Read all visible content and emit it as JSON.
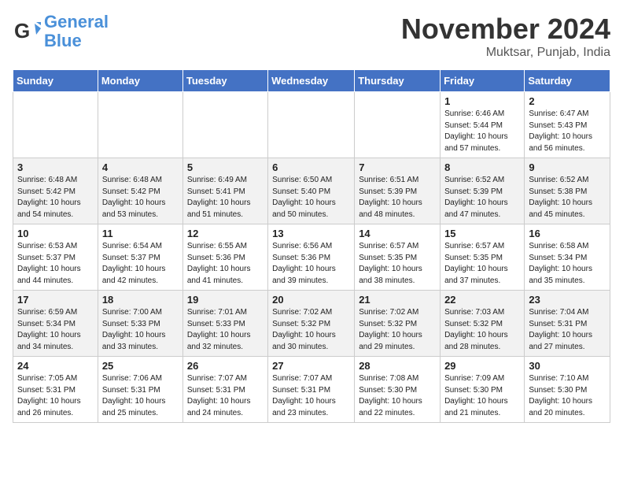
{
  "header": {
    "logo_line1": "General",
    "logo_line2": "Blue",
    "month": "November 2024",
    "location": "Muktsar, Punjab, India"
  },
  "weekdays": [
    "Sunday",
    "Monday",
    "Tuesday",
    "Wednesday",
    "Thursday",
    "Friday",
    "Saturday"
  ],
  "weeks": [
    [
      {
        "day": "",
        "info": ""
      },
      {
        "day": "",
        "info": ""
      },
      {
        "day": "",
        "info": ""
      },
      {
        "day": "",
        "info": ""
      },
      {
        "day": "",
        "info": ""
      },
      {
        "day": "1",
        "info": "Sunrise: 6:46 AM\nSunset: 5:44 PM\nDaylight: 10 hours\nand 57 minutes."
      },
      {
        "day": "2",
        "info": "Sunrise: 6:47 AM\nSunset: 5:43 PM\nDaylight: 10 hours\nand 56 minutes."
      }
    ],
    [
      {
        "day": "3",
        "info": "Sunrise: 6:48 AM\nSunset: 5:42 PM\nDaylight: 10 hours\nand 54 minutes."
      },
      {
        "day": "4",
        "info": "Sunrise: 6:48 AM\nSunset: 5:42 PM\nDaylight: 10 hours\nand 53 minutes."
      },
      {
        "day": "5",
        "info": "Sunrise: 6:49 AM\nSunset: 5:41 PM\nDaylight: 10 hours\nand 51 minutes."
      },
      {
        "day": "6",
        "info": "Sunrise: 6:50 AM\nSunset: 5:40 PM\nDaylight: 10 hours\nand 50 minutes."
      },
      {
        "day": "7",
        "info": "Sunrise: 6:51 AM\nSunset: 5:39 PM\nDaylight: 10 hours\nand 48 minutes."
      },
      {
        "day": "8",
        "info": "Sunrise: 6:52 AM\nSunset: 5:39 PM\nDaylight: 10 hours\nand 47 minutes."
      },
      {
        "day": "9",
        "info": "Sunrise: 6:52 AM\nSunset: 5:38 PM\nDaylight: 10 hours\nand 45 minutes."
      }
    ],
    [
      {
        "day": "10",
        "info": "Sunrise: 6:53 AM\nSunset: 5:37 PM\nDaylight: 10 hours\nand 44 minutes."
      },
      {
        "day": "11",
        "info": "Sunrise: 6:54 AM\nSunset: 5:37 PM\nDaylight: 10 hours\nand 42 minutes."
      },
      {
        "day": "12",
        "info": "Sunrise: 6:55 AM\nSunset: 5:36 PM\nDaylight: 10 hours\nand 41 minutes."
      },
      {
        "day": "13",
        "info": "Sunrise: 6:56 AM\nSunset: 5:36 PM\nDaylight: 10 hours\nand 39 minutes."
      },
      {
        "day": "14",
        "info": "Sunrise: 6:57 AM\nSunset: 5:35 PM\nDaylight: 10 hours\nand 38 minutes."
      },
      {
        "day": "15",
        "info": "Sunrise: 6:57 AM\nSunset: 5:35 PM\nDaylight: 10 hours\nand 37 minutes."
      },
      {
        "day": "16",
        "info": "Sunrise: 6:58 AM\nSunset: 5:34 PM\nDaylight: 10 hours\nand 35 minutes."
      }
    ],
    [
      {
        "day": "17",
        "info": "Sunrise: 6:59 AM\nSunset: 5:34 PM\nDaylight: 10 hours\nand 34 minutes."
      },
      {
        "day": "18",
        "info": "Sunrise: 7:00 AM\nSunset: 5:33 PM\nDaylight: 10 hours\nand 33 minutes."
      },
      {
        "day": "19",
        "info": "Sunrise: 7:01 AM\nSunset: 5:33 PM\nDaylight: 10 hours\nand 32 minutes."
      },
      {
        "day": "20",
        "info": "Sunrise: 7:02 AM\nSunset: 5:32 PM\nDaylight: 10 hours\nand 30 minutes."
      },
      {
        "day": "21",
        "info": "Sunrise: 7:02 AM\nSunset: 5:32 PM\nDaylight: 10 hours\nand 29 minutes."
      },
      {
        "day": "22",
        "info": "Sunrise: 7:03 AM\nSunset: 5:32 PM\nDaylight: 10 hours\nand 28 minutes."
      },
      {
        "day": "23",
        "info": "Sunrise: 7:04 AM\nSunset: 5:31 PM\nDaylight: 10 hours\nand 27 minutes."
      }
    ],
    [
      {
        "day": "24",
        "info": "Sunrise: 7:05 AM\nSunset: 5:31 PM\nDaylight: 10 hours\nand 26 minutes."
      },
      {
        "day": "25",
        "info": "Sunrise: 7:06 AM\nSunset: 5:31 PM\nDaylight: 10 hours\nand 25 minutes."
      },
      {
        "day": "26",
        "info": "Sunrise: 7:07 AM\nSunset: 5:31 PM\nDaylight: 10 hours\nand 24 minutes."
      },
      {
        "day": "27",
        "info": "Sunrise: 7:07 AM\nSunset: 5:31 PM\nDaylight: 10 hours\nand 23 minutes."
      },
      {
        "day": "28",
        "info": "Sunrise: 7:08 AM\nSunset: 5:30 PM\nDaylight: 10 hours\nand 22 minutes."
      },
      {
        "day": "29",
        "info": "Sunrise: 7:09 AM\nSunset: 5:30 PM\nDaylight: 10 hours\nand 21 minutes."
      },
      {
        "day": "30",
        "info": "Sunrise: 7:10 AM\nSunset: 5:30 PM\nDaylight: 10 hours\nand 20 minutes."
      }
    ]
  ]
}
